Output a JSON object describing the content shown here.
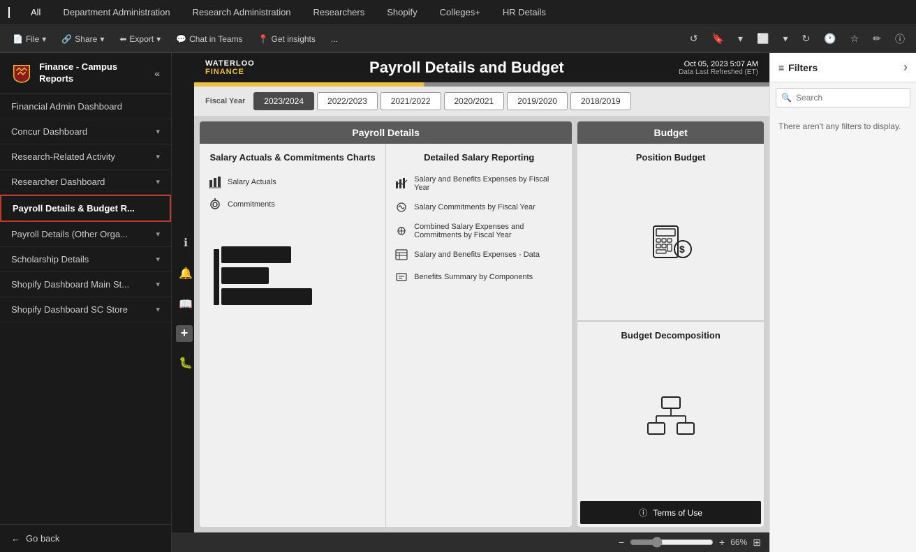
{
  "topnav": {
    "items": [
      "All",
      "Department Administration",
      "Research Administration",
      "Researchers",
      "Shopify",
      "Colleges+",
      "HR Details"
    ]
  },
  "toolbar": {
    "file_label": "File",
    "share_label": "Share",
    "export_label": "Export",
    "chat_label": "Chat in Teams",
    "insights_label": "Get insights",
    "more_label": "..."
  },
  "sidebar": {
    "title": "Finance - Campus Reports",
    "items": [
      {
        "label": "Financial Admin Dashboard",
        "has_chevron": false,
        "active": false
      },
      {
        "label": "Concur Dashboard",
        "has_chevron": true,
        "active": false
      },
      {
        "label": "Research-Related Activity",
        "has_chevron": true,
        "active": false
      },
      {
        "label": "Researcher Dashboard",
        "has_chevron": true,
        "active": false
      },
      {
        "label": "Payroll Details & Budget R...",
        "has_chevron": false,
        "active": true
      },
      {
        "label": "Payroll Details (Other Orga...",
        "has_chevron": true,
        "active": false
      },
      {
        "label": "Scholarship Details",
        "has_chevron": true,
        "active": false
      },
      {
        "label": "Shopify Dashboard Main St...",
        "has_chevron": true,
        "active": false
      },
      {
        "label": "Shopify Dashboard SC Store",
        "has_chevron": true,
        "active": false
      }
    ],
    "go_back_label": "Go back"
  },
  "report": {
    "brand_top": "WATERLOO",
    "brand_bottom": "FINANCE",
    "title": "Payroll Details and Budget",
    "date": "Oct 05, 2023 5:07 AM",
    "date_sub": "Data Last Refreshed (ET)",
    "fiscal_year_label": "Fiscal Year",
    "fiscal_years": [
      {
        "label": "2023/2024",
        "selected": true
      },
      {
        "label": "2022/2023",
        "selected": false
      },
      {
        "label": "2021/2022",
        "selected": false
      },
      {
        "label": "2020/2021",
        "selected": false
      },
      {
        "label": "2019/2020",
        "selected": false
      },
      {
        "label": "2018/2019",
        "selected": false
      }
    ],
    "payroll_header": "Payroll Details",
    "budget_header": "Budget",
    "salary_actuals_title": "Salary Actuals & Commitments Charts",
    "salary_items": [
      {
        "label": "Salary Actuals"
      },
      {
        "label": "Commitments"
      }
    ],
    "detailed_salary_title": "Detailed Salary Reporting",
    "detailed_items": [
      {
        "label": "Salary and Benefits Expenses by Fiscal Year"
      },
      {
        "label": "Salary Commitments by Fiscal Year"
      },
      {
        "label": "Combined Salary Expenses and Commitments by Fiscal Year"
      },
      {
        "label": "Salary and Benefits Expenses - Data"
      },
      {
        "label": "Benefits Summary by Components"
      }
    ],
    "position_budget_title": "Position Budget",
    "budget_decomp_title": "Budget Decomposition",
    "terms_label": "Terms of Use",
    "zoom_level": "66%"
  },
  "filters": {
    "title": "Filters",
    "search_placeholder": "Search",
    "empty_message": "There aren't any filters to display.",
    "expand_icon": "›"
  },
  "side_icons": {
    "info": "ℹ",
    "bell": "🔔",
    "book": "📖",
    "plus": "+",
    "bug": "🐛"
  }
}
